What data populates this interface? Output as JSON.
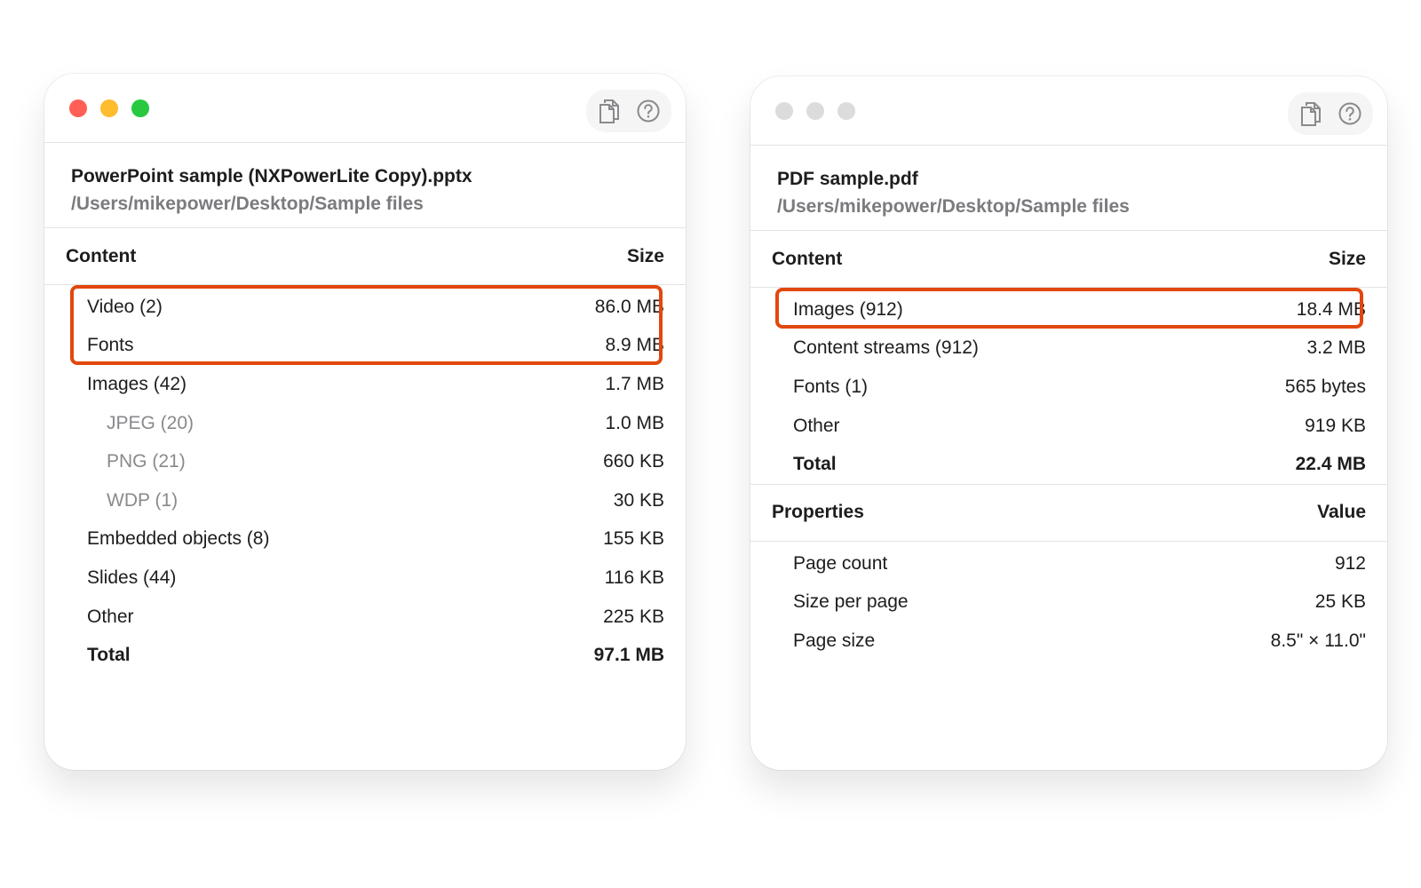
{
  "colors": {
    "traffic_red": "#ff5f57",
    "traffic_yellow": "#febc2e",
    "traffic_green": "#28c840",
    "traffic_inactive": "#dcdcdc",
    "highlight": "#e2470f"
  },
  "left": {
    "icons": [
      "copy-icon",
      "help-icon"
    ],
    "file_name": "PowerPoint sample (NXPowerLite Copy).pptx",
    "file_path": "/Users/mikepower/Desktop/Sample files",
    "content_header": "Content",
    "size_header": "Size",
    "rows": [
      {
        "label": "Video (2)",
        "value": "86.0 MB"
      },
      {
        "label": "Fonts",
        "value": "8.9 MB"
      },
      {
        "label": "Images (42)",
        "value": "1.7 MB"
      },
      {
        "label": "JPEG (20)",
        "value": "1.0 MB"
      },
      {
        "label": "PNG (21)",
        "value": "660 KB"
      },
      {
        "label": "WDP (1)",
        "value": "30 KB"
      },
      {
        "label": "Embedded objects (8)",
        "value": "155 KB"
      },
      {
        "label": "Slides (44)",
        "value": "116 KB"
      },
      {
        "label": "Other",
        "value": "225 KB"
      },
      {
        "label": "Total",
        "value": "97.1 MB"
      }
    ]
  },
  "right": {
    "icons": [
      "copy-icon",
      "help-icon"
    ],
    "file_name": "PDF sample.pdf",
    "file_path": "/Users/mikepower/Desktop/Sample files",
    "content_header": "Content",
    "size_header": "Size",
    "rows": [
      {
        "label": "Images (912)",
        "value": "18.4 MB"
      },
      {
        "label": "Content streams (912)",
        "value": "3.2 MB"
      },
      {
        "label": "Fonts (1)",
        "value": "565 bytes"
      },
      {
        "label": "Other",
        "value": "919 KB"
      },
      {
        "label": "Total",
        "value": "22.4 MB"
      }
    ],
    "properties_header": "Properties",
    "value_header": "Value",
    "properties": [
      {
        "label": "Page count",
        "value": "912"
      },
      {
        "label": "Size per page",
        "value": "25 KB"
      },
      {
        "label": "Page size",
        "value": "8.5\" × 11.0\""
      }
    ]
  }
}
